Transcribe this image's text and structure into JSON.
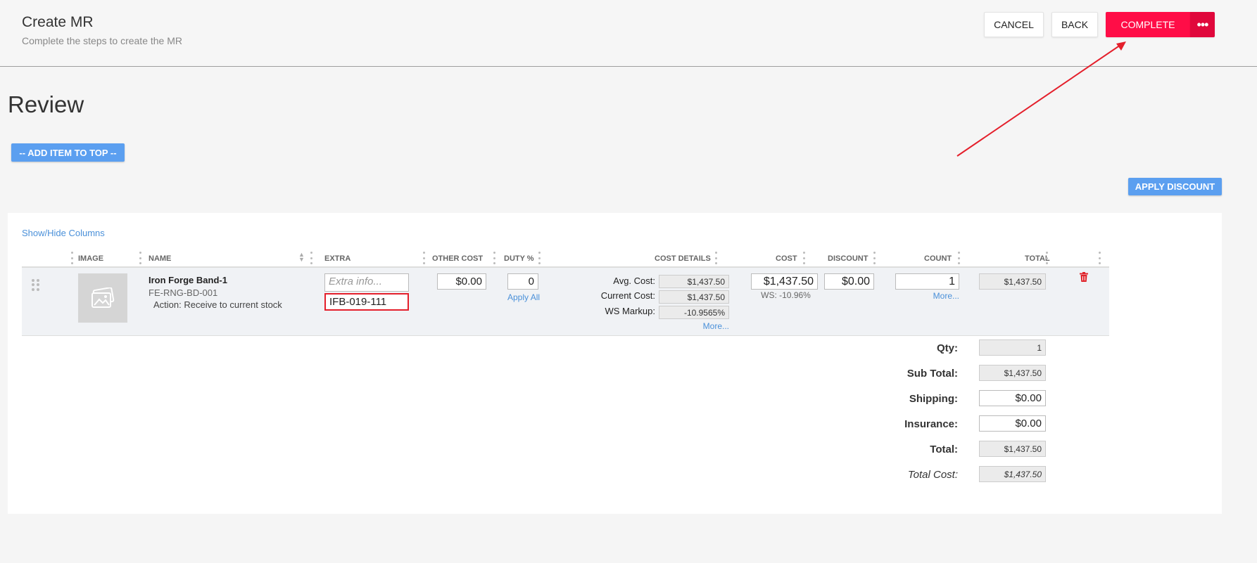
{
  "header": {
    "title": "Create MR",
    "subtitle": "Complete the steps to create the MR",
    "cancel_label": "CANCEL",
    "back_label": "BACK",
    "complete_label": "COMPLETE",
    "more_label": "•••"
  },
  "review": {
    "title": "Review",
    "add_item_label": "-- ADD ITEM TO TOP --",
    "apply_discount_label": "APPLY DISCOUNT",
    "show_hide_label": "Show/Hide Columns"
  },
  "columns": [
    "IMAGE",
    "NAME",
    "EXTRA",
    "OTHER COST",
    "DUTY %",
    "COST DETAILS",
    "COST",
    "DISCOUNT",
    "COUNT",
    "TOTAL"
  ],
  "item": {
    "name": "Iron Forge Band-1",
    "sku": "FE-RNG-BD-001",
    "action": "Action: Receive to current stock",
    "extra_placeholder": "Extra info...",
    "extra_value": "IFB-019-111",
    "other_cost": "$0.00",
    "duty": "0",
    "apply_all": "Apply All",
    "avg_cost_label": "Avg. Cost:",
    "avg_cost": "$1,437.50",
    "current_cost_label": "Current Cost:",
    "current_cost": "$1,437.50",
    "ws_markup_label": "WS Markup:",
    "ws_markup": "-10.9565%",
    "cost_more": "More...",
    "cost": "$1,437.50",
    "ws_note": "WS: -10.96%",
    "discount": "$0.00",
    "count": "1",
    "count_more": "More...",
    "total": "$1,437.50"
  },
  "summary": {
    "qty_label": "Qty:",
    "qty": "1",
    "subtotal_label": "Sub Total:",
    "subtotal": "$1,437.50",
    "shipping_label": "Shipping:",
    "shipping": "$0.00",
    "insurance_label": "Insurance:",
    "insurance": "$0.00",
    "total_label": "Total:",
    "total": "$1,437.50",
    "total_cost_label": "Total Cost:",
    "total_cost": "$1,437.50"
  },
  "colors": {
    "accent_red": "#ff0d47",
    "accent_blue": "#5b9ff0",
    "link_blue": "#4a90d9",
    "highlight_red": "#e41f2b"
  }
}
